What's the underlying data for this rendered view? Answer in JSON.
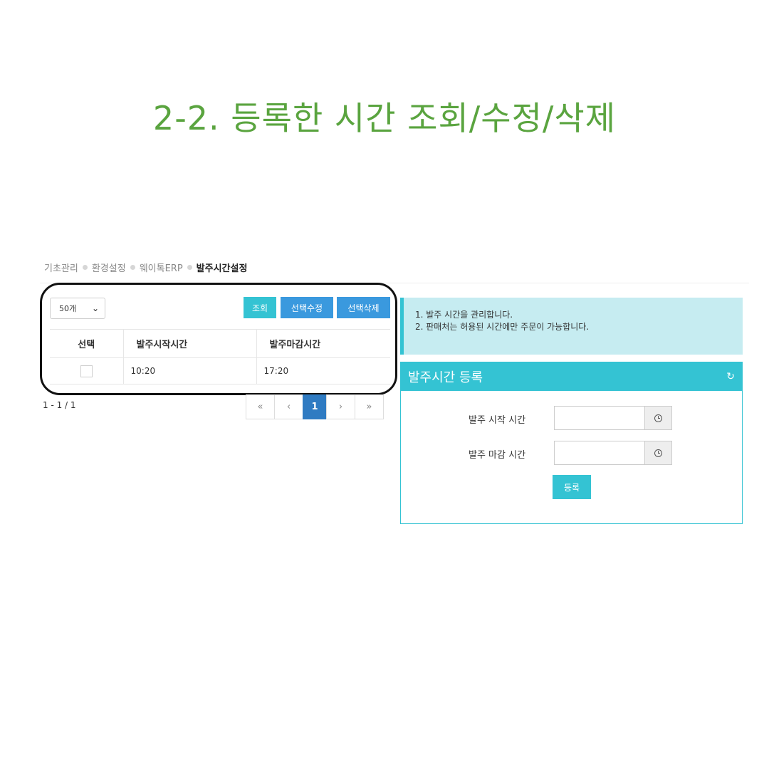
{
  "title": "2-2. 등록한 시간 조회/수정/삭제",
  "breadcrumb": {
    "items": [
      "기초관리",
      "환경설정",
      "웨이톡ERP"
    ],
    "current": "발주시간설정"
  },
  "list": {
    "page_size": "50개",
    "buttons": {
      "search": "조회",
      "edit": "선택수정",
      "delete": "선택삭제"
    },
    "columns": [
      "선택",
      "발주시작시간",
      "발주마감시간"
    ],
    "rows": [
      {
        "checked": false,
        "start": "10:20",
        "end": "17:20"
      }
    ],
    "count": "1 - 1 / 1",
    "pager": {
      "first": "«",
      "prev": "‹",
      "current": "1",
      "next": "›",
      "last": "»"
    }
  },
  "info": {
    "lines": [
      "1. 발주 시간을 관리합니다.",
      "2. 판매처는 허용된 시간에만 주문이 가능합니다."
    ]
  },
  "register": {
    "title": "발주시간 등록",
    "start_label": "발주 시작 시간",
    "end_label": "발주 마감 시간",
    "start_value": "",
    "end_value": "",
    "submit": "등록"
  },
  "icons": {
    "refresh": "refresh-icon",
    "clock": "clock-icon",
    "select_chevron": "chevron-down-icon"
  },
  "colors": {
    "title_green": "#5aa43f",
    "accent_cyan": "#34c3d3",
    "button_blue": "#3a99de",
    "pager_active": "#2f7bc2",
    "info_bg": "#c6ecf1"
  }
}
